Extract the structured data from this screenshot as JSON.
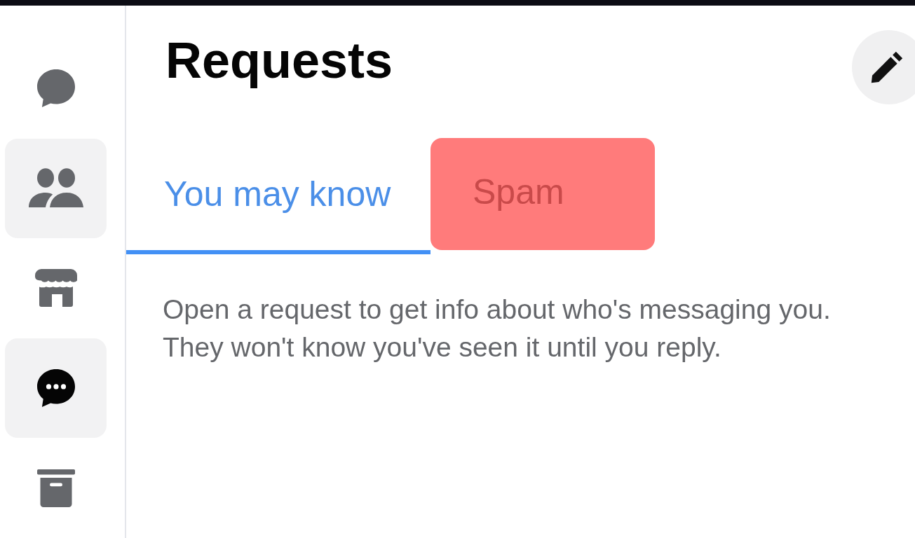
{
  "sidebar": {
    "items": [
      {
        "kind": "chats",
        "selected": false,
        "hovered": false
      },
      {
        "kind": "people",
        "selected": false,
        "hovered": true
      },
      {
        "kind": "marketplace",
        "selected": false,
        "hovered": false
      },
      {
        "kind": "requests",
        "selected": true,
        "hovered": false
      },
      {
        "kind": "archive",
        "selected": false,
        "hovered": false
      }
    ]
  },
  "header": {
    "title": "Requests"
  },
  "tabs": [
    {
      "label": "You may know",
      "selected": true,
      "highlighted": false
    },
    {
      "label": "Spam",
      "selected": false,
      "highlighted": true
    }
  ],
  "description": [
    "Open a request to get info about who's messaging you.",
    "They won't know you've seen it until you reply."
  ]
}
